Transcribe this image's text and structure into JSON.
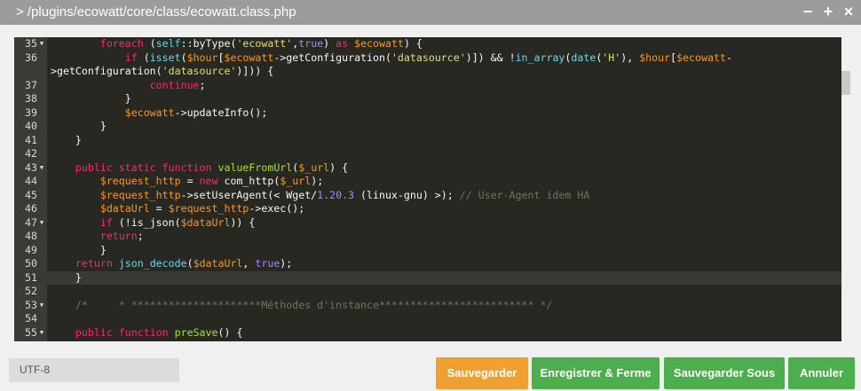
{
  "window": {
    "title": "> /plugins/ecowatt/core/class/ecowatt.class.php",
    "minimize_icon": "−",
    "maximize_icon": "+",
    "close_icon": "×"
  },
  "editor": {
    "lines": [
      {
        "n": "35",
        "fold": "▼",
        "html": "        <span class=\"kw\">foreach</span> (<span class=\"bi\">self</span>::byType(<span class=\"str\">'ecowatt'</span>,<span class=\"num\">true</span>) <span class=\"kw\">as</span> <span class=\"var\">$ecowatt</span>) {"
      },
      {
        "n": "36",
        "fold": "",
        "html": "            <span class=\"kw\">if</span> (<span class=\"bi\">isset</span>(<span class=\"var\">$hour</span>[<span class=\"var\">$ecowatt</span>-&gt;getConfiguration(<span class=\"str\">'datasource'</span>)]) &amp;&amp; !<span class=\"bi\">in_array</span>(<span class=\"bi\">date</span>(<span class=\"str\">'H'</span>), <span class=\"var\">$hour</span>[<span class=\"var\">$ecowatt</span>-"
      },
      {
        "n": "",
        "fold": "",
        "html": "&gt;getConfiguration(<span class=\"str\">'datasource'</span>)])) {"
      },
      {
        "n": "37",
        "fold": "",
        "html": "                <span class=\"kw\">continue</span>;"
      },
      {
        "n": "38",
        "fold": "",
        "html": "            }"
      },
      {
        "n": "39",
        "fold": "",
        "html": "            <span class=\"var\">$ecowatt</span>-&gt;updateInfo();"
      },
      {
        "n": "40",
        "fold": "",
        "html": "        }"
      },
      {
        "n": "41",
        "fold": "",
        "html": "    }"
      },
      {
        "n": "42",
        "fold": "",
        "html": ""
      },
      {
        "n": "43",
        "fold": "▼",
        "html": "    <span class=\"kw\">public</span> <span class=\"kw\">static</span> <span class=\"kw\">function</span> <span class=\"fn\">valueFromUrl</span>(<span class=\"var\">$_url</span>) {"
      },
      {
        "n": "44",
        "fold": "",
        "html": "        <span class=\"var\">$request_http</span> = <span class=\"kw\">new</span> com_http(<span class=\"var\">$_url</span>);"
      },
      {
        "n": "45",
        "fold": "",
        "html": "        <span class=\"var\">$request_http</span>-&gt;setUserAgent(&lt; Wget/<span class=\"num\">1.20.3</span> (linux-gnu) &gt;); <span class=\"cm\">// User-Agent idem HA</span>"
      },
      {
        "n": "46",
        "fold": "",
        "html": "        <span class=\"var\">$dataUrl</span> = <span class=\"var\">$request_http</span>-&gt;exec();"
      },
      {
        "n": "47",
        "fold": "▼",
        "html": "        <span class=\"kw\">if</span> (!is_json(<span class=\"var\">$dataUrl</span>)) {"
      },
      {
        "n": "48",
        "fold": "",
        "html": "        <span class=\"kw\">return</span>;"
      },
      {
        "n": "49",
        "fold": "",
        "html": "        }"
      },
      {
        "n": "50",
        "fold": "",
        "html": "    <span class=\"kw\">return</span> <span class=\"bi\">json_decode</span>(<span class=\"var\">$dataUrl</span>, <span class=\"num\">true</span>);"
      },
      {
        "n": "51",
        "fold": "",
        "active": true,
        "html": "    }"
      },
      {
        "n": "52",
        "fold": "",
        "html": ""
      },
      {
        "n": "53",
        "fold": "▼",
        "html": "    <span class=\"cm\">/*     * *********************Méthodes d'instance************************* */</span>"
      },
      {
        "n": "54",
        "fold": "",
        "html": ""
      },
      {
        "n": "55",
        "fold": "▼",
        "html": "    <span class=\"kw\">public</span> <span class=\"kw\">function</span> <span class=\"fn\">preSave</span>() {"
      }
    ]
  },
  "footer": {
    "encoding": "UTF-8",
    "buttons": {
      "save": "Sauvegarder",
      "save_close": "Enregistrer & Ferme",
      "save_as": "Sauvegarder Sous",
      "cancel": "Annuler"
    }
  },
  "colors": {
    "save": "#f0a030",
    "green": "#4cae4c",
    "titlebar": "#9c9c9c",
    "editor_bg": "#272822"
  }
}
